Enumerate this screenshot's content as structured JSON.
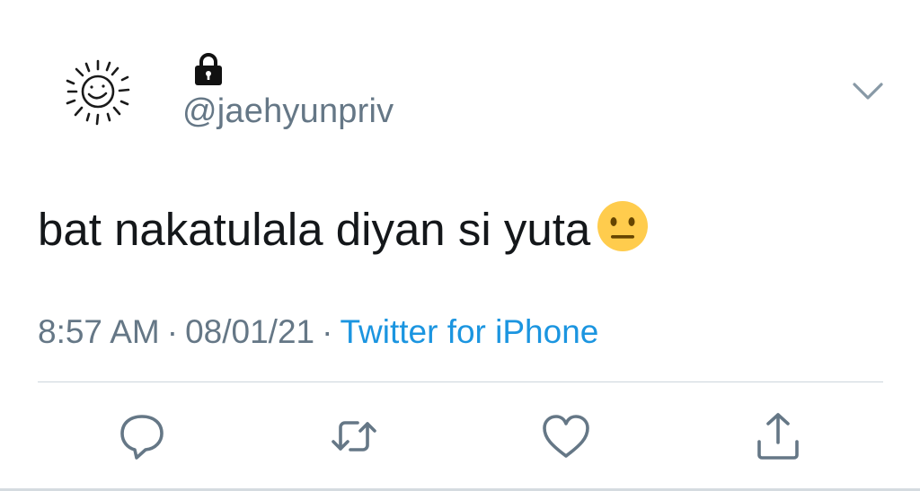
{
  "tweet": {
    "avatar_icon": "hand-drawn-sun-avatar",
    "locked_icon": "lock-icon",
    "handle": "@jaehyunpriv",
    "menu_icon": "chevron-down-icon",
    "text": "bat nakatulala diyan si yuta",
    "emoji": "neutral-face-emoji",
    "time": "8:57 AM",
    "date": "08/01/21",
    "separator": "·",
    "source": "Twitter for iPhone"
  },
  "actions": [
    {
      "name": "reply",
      "icon": "reply-icon"
    },
    {
      "name": "retweet",
      "icon": "retweet-icon"
    },
    {
      "name": "like",
      "icon": "heart-icon"
    },
    {
      "name": "share",
      "icon": "share-icon"
    }
  ],
  "colors": {
    "text": "#14171a",
    "secondary": "#657786",
    "link": "#1b95e0",
    "divider": "#ccd6dd",
    "icon": "#657786",
    "emoji_fill": "#ffcc4d"
  }
}
